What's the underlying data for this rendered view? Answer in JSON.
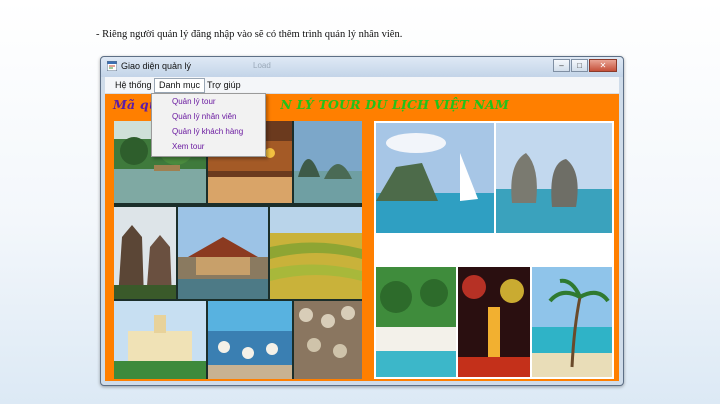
{
  "caption": "- Riêng người quản lý đăng nhập vào sẽ có thêm trình quản lý nhân viên.",
  "window": {
    "title": "Giao diện quản lý",
    "ghost_text": "Load",
    "icon": "form-app-icon",
    "caption_buttons": {
      "minimize": "–",
      "maximize": "□",
      "close": "✕"
    }
  },
  "menubar": {
    "items": [
      "Hệ thống",
      "Danh mục",
      "Trợ giúp"
    ],
    "open_item": "Danh mục"
  },
  "dropdown": {
    "items": [
      "Quản lý tour",
      "Quản lý nhân viên",
      "Quản lý khách hàng",
      "Xem tour"
    ]
  },
  "banner": {
    "prefix": "Mã quả",
    "suffix": "N LÝ TOUR DU LỊCH VIỆT NAM"
  },
  "colors": {
    "content_background": "#ff7f00",
    "banner_green": "#22c21a",
    "banner_purple": "#5a1ca8",
    "menu_text_purple": "#6a1aa0"
  },
  "photos": {
    "left": [
      "riverside-village-photo",
      "hoi-an-street-photo",
      "ha-long-islands-photo",
      "cham-towers-photo",
      "hue-citadel-photo",
      "rice-terraces-photo",
      "saigon-city-hall-photo",
      "fishing-market-photo",
      "conical-hats-crowd-photo"
    ],
    "right": [
      "sailboat-island-photo",
      "kissing-rocks-photo",
      "tropical-resort-photo",
      "fireworks-photo",
      "palm-beach-photo"
    ]
  }
}
